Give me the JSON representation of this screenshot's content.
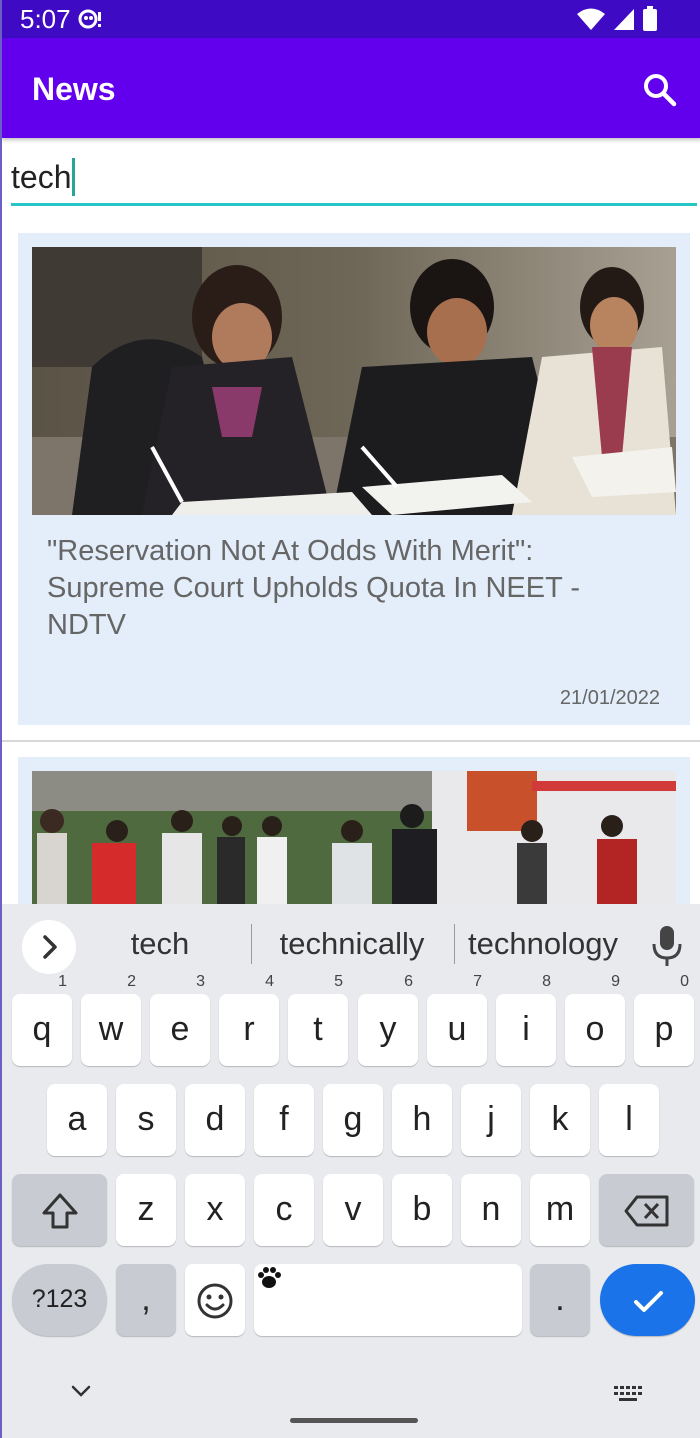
{
  "status_bar": {
    "time": "5:07",
    "icons": [
      "notification-icon",
      "wifi-icon",
      "signal-icon",
      "battery-icon"
    ]
  },
  "app_bar": {
    "title": "News",
    "search_icon": "search-icon"
  },
  "search": {
    "value": "tech"
  },
  "articles": [
    {
      "title": "\"Reservation Not At Odds With Merit\": Supreme Court Upholds Quota In NEET - NDTV",
      "date": "21/01/2022",
      "image": "students-writing-exam-photo"
    },
    {
      "title": "",
      "date": "",
      "image": "crowd-outside-ambulance-photo"
    }
  ],
  "keyboard": {
    "suggestions": [
      "tech",
      "technically",
      "technology"
    ],
    "row1": [
      {
        "key": "q",
        "hint": "1"
      },
      {
        "key": "w",
        "hint": "2"
      },
      {
        "key": "e",
        "hint": "3"
      },
      {
        "key": "r",
        "hint": "4"
      },
      {
        "key": "t",
        "hint": "5"
      },
      {
        "key": "y",
        "hint": "6"
      },
      {
        "key": "u",
        "hint": "7"
      },
      {
        "key": "i",
        "hint": "8"
      },
      {
        "key": "o",
        "hint": "9"
      },
      {
        "key": "p",
        "hint": "0"
      }
    ],
    "row2": [
      "a",
      "s",
      "d",
      "f",
      "g",
      "h",
      "j",
      "k",
      "l"
    ],
    "row3": [
      "z",
      "x",
      "c",
      "v",
      "b",
      "n",
      "m"
    ],
    "symbols_label": "?123",
    "comma_label": ",",
    "period_label": ".",
    "colors": {
      "enter": "#1a73e8",
      "accent": "#26c6c6",
      "app_bar": "#6200ee",
      "status_bar": "#3f0ac4"
    }
  }
}
